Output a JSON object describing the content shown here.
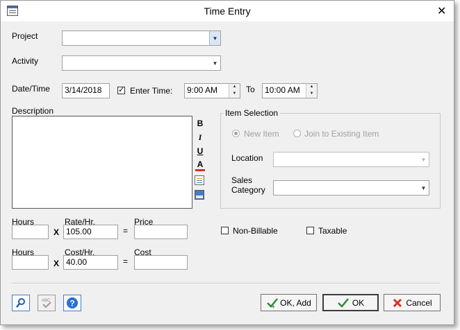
{
  "window": {
    "title": "Time Entry",
    "close_glyph": "✕"
  },
  "project": {
    "label": "Project",
    "value": ""
  },
  "activity": {
    "label": "Activity",
    "value": ""
  },
  "datetime": {
    "label": "Date/Time",
    "date": "3/14/2018",
    "enter_time_label": "Enter Time:",
    "enter_time_checked": true,
    "from_time": "9:00 AM",
    "to_label": "To",
    "to_time": "10:00 AM"
  },
  "description": {
    "label": "Description",
    "value": ""
  },
  "format_toolbar": {
    "bold": "B",
    "italic": "I",
    "underline": "U",
    "color": "A"
  },
  "item_selection": {
    "legend": "Item Selection",
    "new_item_label": "New Item",
    "join_existing_label": "Join to Existing Item",
    "location_label": "Location",
    "location_value": "",
    "sales_category_label_1": "Sales",
    "sales_category_label_2": "Category",
    "sales_category_value": ""
  },
  "billing": {
    "hours_label": "Hours",
    "rate_label": "Rate/Hr.",
    "rate_value": "105.00",
    "price_label": "Price",
    "times_symbol": "X",
    "equals_symbol": "=",
    "hours_value": "",
    "price_value": ""
  },
  "costing": {
    "hours_label": "Hours",
    "cost_label": "Cost/Hr.",
    "cost_value": "40.00",
    "total_label": "Cost",
    "times_symbol": "X",
    "equals_symbol": "=",
    "hours_value": "",
    "total_value": ""
  },
  "options": {
    "non_billable_label": "Non-Billable",
    "non_billable_checked": false,
    "taxable_label": "Taxable",
    "taxable_checked": false
  },
  "buttons": {
    "ok_add": "OK, Add",
    "ok": "OK",
    "cancel": "Cancel"
  },
  "colors": {
    "accent": "#3f79c8",
    "ok_check": "#2e8b3a",
    "cancel_x": "#d93025"
  }
}
